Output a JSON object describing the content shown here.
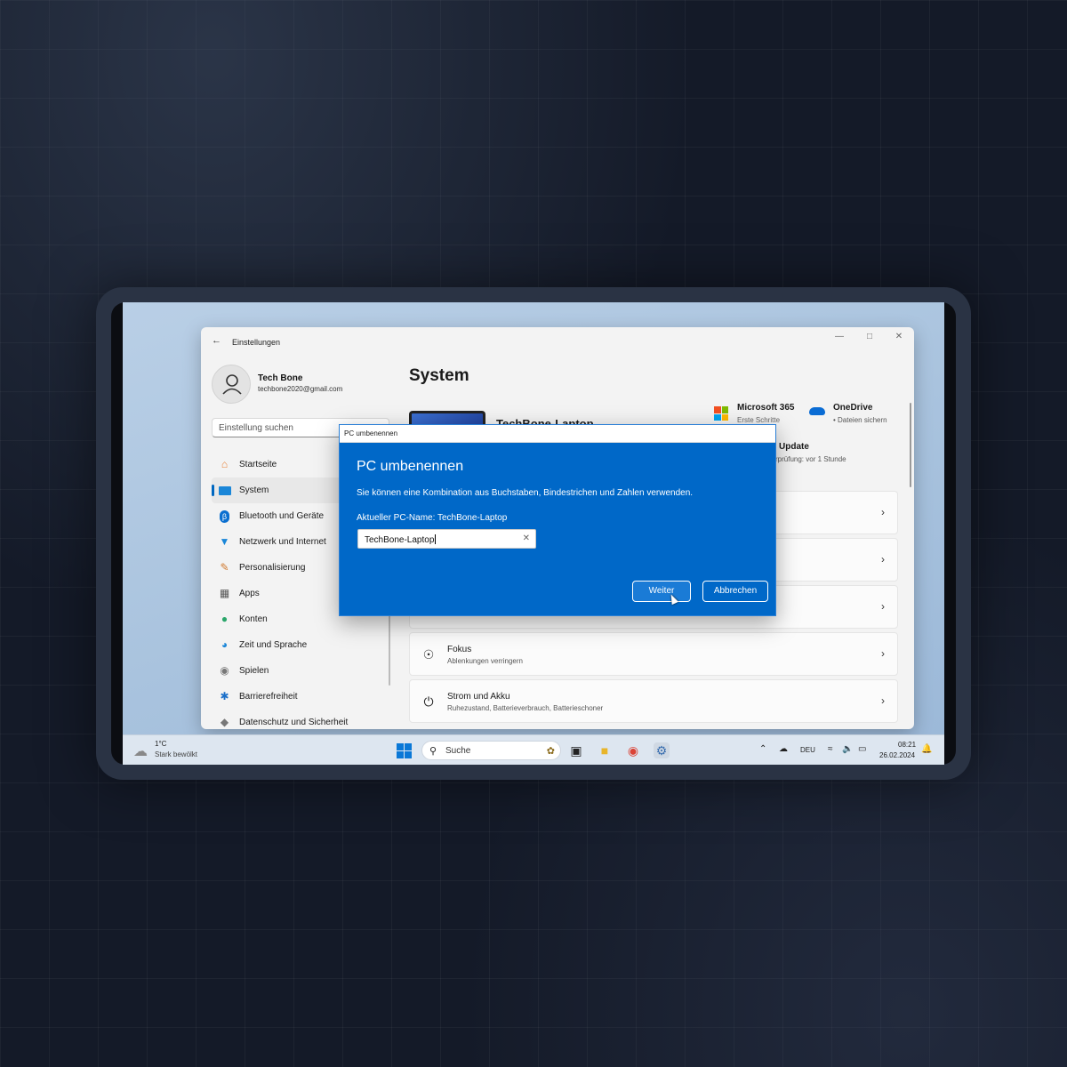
{
  "window": {
    "title": "Einstellungen",
    "profile": {
      "name": "Tech Bone",
      "email": "techbone2020@gmail.com"
    },
    "search_placeholder": "Einstellung suchen",
    "nav": [
      {
        "label": "Startseite",
        "icon": "home-icon"
      },
      {
        "label": "System",
        "icon": "monitor-icon"
      },
      {
        "label": "Bluetooth und Geräte",
        "icon": "bluetooth-icon"
      },
      {
        "label": "Netzwerk und Internet",
        "icon": "wifi-icon"
      },
      {
        "label": "Personalisierung",
        "icon": "brush-icon"
      },
      {
        "label": "Apps",
        "icon": "apps-icon"
      },
      {
        "label": "Konten",
        "icon": "person-icon"
      },
      {
        "label": "Zeit und Sprache",
        "icon": "globe-clock-icon"
      },
      {
        "label": "Spielen",
        "icon": "gamepad-icon"
      },
      {
        "label": "Barrierefreiheit",
        "icon": "accessibility-icon"
      },
      {
        "label": "Datenschutz und Sicherheit",
        "icon": "shield-icon"
      }
    ],
    "active_nav": "System",
    "page_title": "System",
    "device_name": "TechBone-Laptop",
    "ms365": {
      "title": "Microsoft 365",
      "subtitle": "Erste Schritte"
    },
    "onedrive": {
      "title": "OneDrive",
      "subtitle": "• Dateien sichern"
    },
    "update": {
      "title": "Update",
      "subtitle": "rprüfung: vor 1 Stunde"
    },
    "cards": [
      {
        "title": "Fokus",
        "subtitle": "Ablenkungen verringern",
        "icon": "focus-icon"
      },
      {
        "title": "Strom und Akku",
        "subtitle": "Ruhezustand, Batterieverbrauch, Batterieschoner",
        "icon": "power-icon"
      }
    ]
  },
  "dialog": {
    "window_title": "PC umbenennen",
    "heading": "PC umbenennen",
    "description": "Sie können eine Kombination aus Buchstaben, Bindestrichen und Zahlen verwenden.",
    "current_name_label": "Aktueller PC-Name: TechBone-Laptop",
    "input_value": "TechBone-Laptop",
    "next_label": "Weiter",
    "cancel_label": "Abbrechen"
  },
  "taskbar": {
    "weather_temp": "1°C",
    "weather_desc": "Stark bewölkt",
    "search_label": "Suche",
    "language": "DEU",
    "time": "08:21",
    "date": "26.02.2024"
  },
  "colors": {
    "accent": "#0067c0",
    "dialog_bg": "#0068c8"
  }
}
